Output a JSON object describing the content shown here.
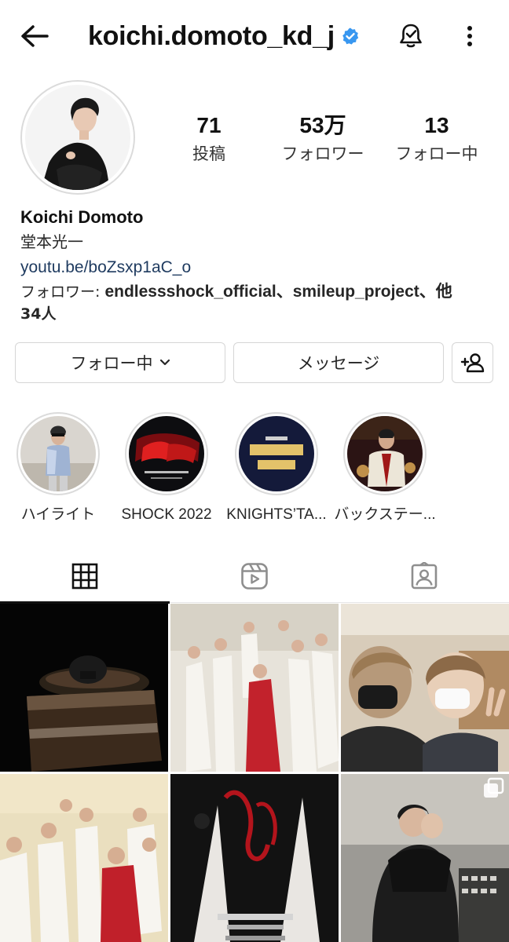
{
  "header": {
    "username": "koichi.domoto_kd_j",
    "back_icon": "arrow-left-icon",
    "verified_icon": "verified-badge-icon",
    "bell_icon": "notification-bell-icon",
    "more_icon": "more-vertical-icon",
    "verified_color": "#3897f0"
  },
  "profile": {
    "stats": [
      {
        "value": "71",
        "label": "投稿"
      },
      {
        "value": "53万",
        "label": "フォロワー"
      },
      {
        "value": "13",
        "label": "フォロー中"
      }
    ],
    "name": "Koichi Domoto",
    "kanji_name": "堂本光一",
    "link": "youtu.be/boZsxp1aC_o",
    "followers_prefix": "フォロワー: ",
    "followers_names": "endlessshock_official、smileup_project、他",
    "followers_count": "34人"
  },
  "actions": {
    "follow_label": "フォロー中",
    "message_label": "メッセージ",
    "add_user_icon": "add-person-icon"
  },
  "highlights": [
    {
      "label": "ハイライト"
    },
    {
      "label": "SHOCK 2022"
    },
    {
      "label": "KNIGHTS’TA..."
    },
    {
      "label": "バックステー..."
    }
  ],
  "tabs": [
    {
      "icon": "grid-icon",
      "active": true
    },
    {
      "icon": "reels-icon",
      "active": false
    },
    {
      "icon": "tagged-icon",
      "active": false
    }
  ],
  "colors": {
    "link": "#1e3a5f",
    "border": "#dbdbdb",
    "text": "#262626"
  }
}
